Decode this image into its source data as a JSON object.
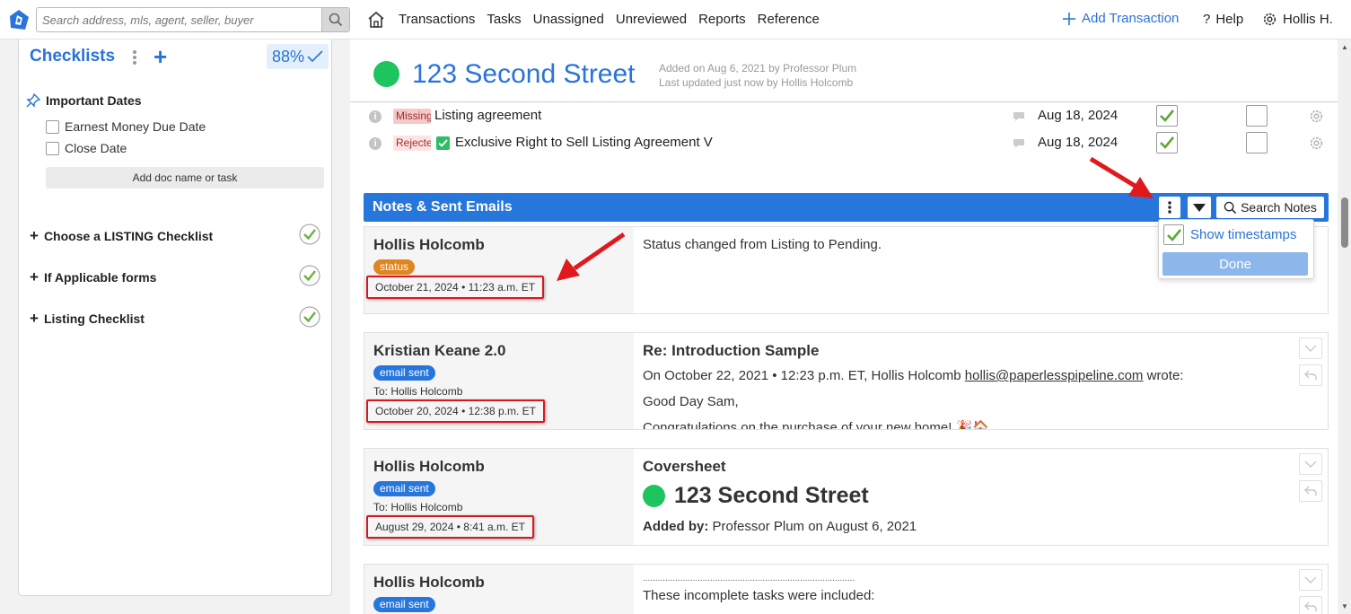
{
  "search": {
    "placeholder": "Search address, mls, agent, seller, buyer"
  },
  "nav": {
    "items": [
      "Transactions",
      "Tasks",
      "Unassigned",
      "Unreviewed",
      "Reports",
      "Reference"
    ],
    "add_transaction": "Add Transaction",
    "help": "Help",
    "user": "Hollis H."
  },
  "checklists": {
    "title": "Checklists",
    "percent": "88%",
    "important_dates": "Important Dates",
    "date_items": [
      "Earnest Money Due Date",
      "Close Date"
    ],
    "add_doc": "Add doc name or task",
    "sections": [
      "Choose a LISTING Checklist",
      "If Applicable forms",
      "Listing Checklist"
    ]
  },
  "property": {
    "title": "123 Second Street",
    "added": "Added on Aug 6, 2021 by Professor Plum",
    "updated": "Last updated just now by Hollis Holcomb"
  },
  "documents": [
    {
      "tag": "Missing",
      "name": "Listing agreement",
      "date": "Aug 18, 2024"
    },
    {
      "tag": "Rejected",
      "name": "Exclusive Right to Sell Listing Agreement V",
      "date": "Aug 18, 2024"
    }
  ],
  "notes_bar": {
    "title": "Notes & Sent Emails",
    "search": "Search Notes",
    "dropdown": {
      "show_timestamps": "Show timestamps",
      "done": "Done"
    }
  },
  "notes": [
    {
      "author": "Hollis Holcomb",
      "badge": "status",
      "timestamp": "October 21, 2024 • 11:23 a.m. ET",
      "body": "Status changed from Listing to Pending."
    },
    {
      "author": "Kristian Keane 2.0",
      "badge": "email sent",
      "to": "To: Hollis Holcomb",
      "timestamp": "October 20, 2024 • 12:38 p.m. ET",
      "subject": "Re: Introduction Sample",
      "line1_prefix": "On October 22, 2021 • 12:23 p.m. ET, Hollis Holcomb ",
      "line1_email": "hollis@paperlesspipeline.com",
      "line1_suffix": " wrote:",
      "line2": "Good Day Sam,",
      "line3": "Congratulations on the purchase of your new home! 🎉🏠"
    },
    {
      "author": "Hollis Holcomb",
      "badge": "email sent",
      "to": "To: Hollis Holcomb",
      "timestamp": "August 29, 2024 • 8:41 a.m. ET",
      "subject": "Coversheet",
      "cover_title": "123 Second Street",
      "added_by_label": "Added by:",
      "added_by_value": " Professor Plum on August 6, 2021"
    },
    {
      "author": "Hollis Holcomb",
      "badge": "email sent",
      "dotted": "............................................................................................",
      "line1": "These incomplete tasks were included:"
    }
  ],
  "colors": {
    "accent": "#2676db",
    "brand_blue": "#2a73d9",
    "status_green": "#1ec45e",
    "highlight_red": "#d8181e"
  }
}
